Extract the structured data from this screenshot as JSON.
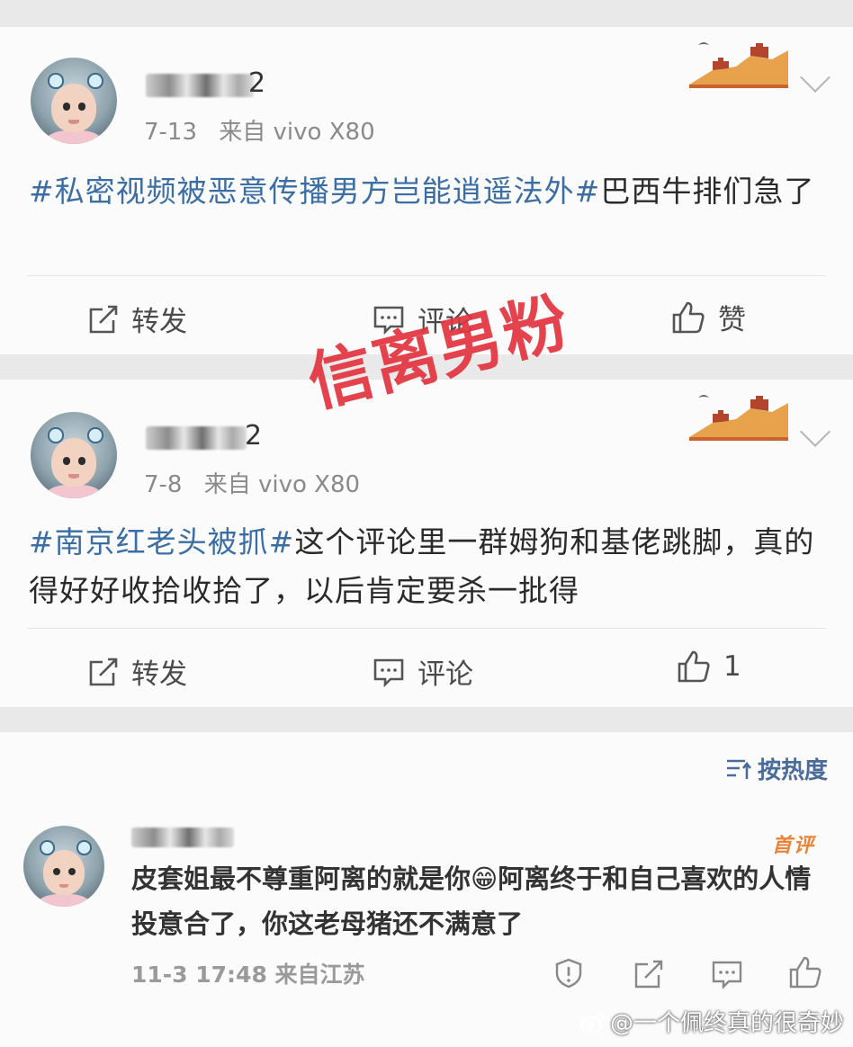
{
  "posts": [
    {
      "name_suffix": "2",
      "date": "7-13",
      "source": "来自 vivo X80",
      "hashtag": "#私密视频被恶意传播男方岂能逍遥法外#",
      "text": "巴西牛排们急了",
      "actions": {
        "repost": "转发",
        "comment": "评论",
        "like": "赞"
      }
    },
    {
      "name_suffix": "2",
      "date": "7-8",
      "source": "来自 vivo X80",
      "hashtag": "#南京红老头被抓#",
      "text": "这个评论里一群姆狗和基佬跳脚，真的得好好收拾收拾了，以后肯定要杀一批得",
      "actions": {
        "repost": "转发",
        "comment": "评论",
        "like": "1"
      }
    }
  ],
  "watermark": "信离男粉",
  "comments_section": {
    "sort_label": "按热度",
    "comment": {
      "badge": "首评",
      "text": "皮套姐最不尊重阿离的就是你😁阿离终于和自己喜欢的人情投意合了，你这老母猪还不满意了",
      "meta": "11-3 17:48 来自江苏"
    }
  },
  "credit": "@一个佩终真的很奇妙",
  "icons": [
    "repost-icon",
    "comment-icon",
    "like-icon",
    "report-icon",
    "chevron-down-icon",
    "great-wall-badge-icon",
    "weibo-logo-icon",
    "sort-icon"
  ],
  "colors": {
    "hashtag": "#3a6ea5",
    "watermark": "#e3343f",
    "badge": "#e8833a"
  }
}
